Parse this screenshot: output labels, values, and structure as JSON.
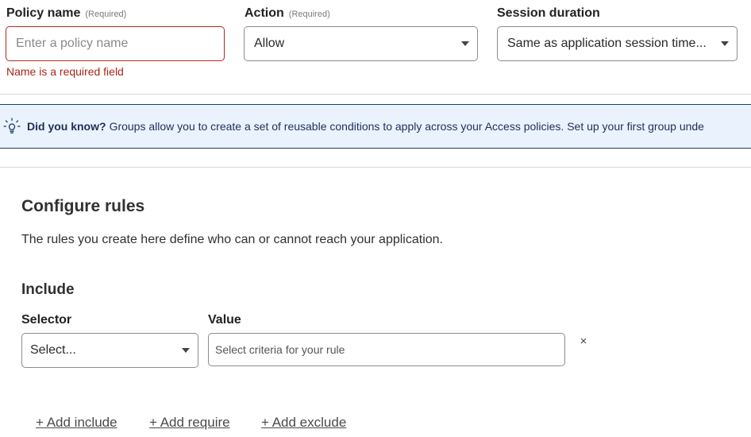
{
  "policy_name": {
    "label": "Policy name",
    "required_tag": "(Required)",
    "placeholder": "Enter a policy name",
    "error": "Name is a required field"
  },
  "action": {
    "label": "Action",
    "required_tag": "(Required)",
    "value": "Allow"
  },
  "session_duration": {
    "label": "Session duration",
    "value": "Same as application session time..."
  },
  "banner": {
    "icon": "lightbulb-icon",
    "strong": "Did you know?",
    "message": "Groups allow you to create a set of reusable conditions to apply across your Access policies. Set up your first group unde"
  },
  "rules": {
    "title": "Configure rules",
    "description": "The rules you create here define who can or cannot reach your application.",
    "include_title": "Include",
    "selector_label": "Selector",
    "selector_value": "Select...",
    "value_label": "Value",
    "value_placeholder": "Select criteria for your rule",
    "remove_glyph": "×"
  },
  "actions": {
    "add_include": "+ Add include",
    "add_require": "+ Add require",
    "add_exclude": "+ Add exclude"
  }
}
